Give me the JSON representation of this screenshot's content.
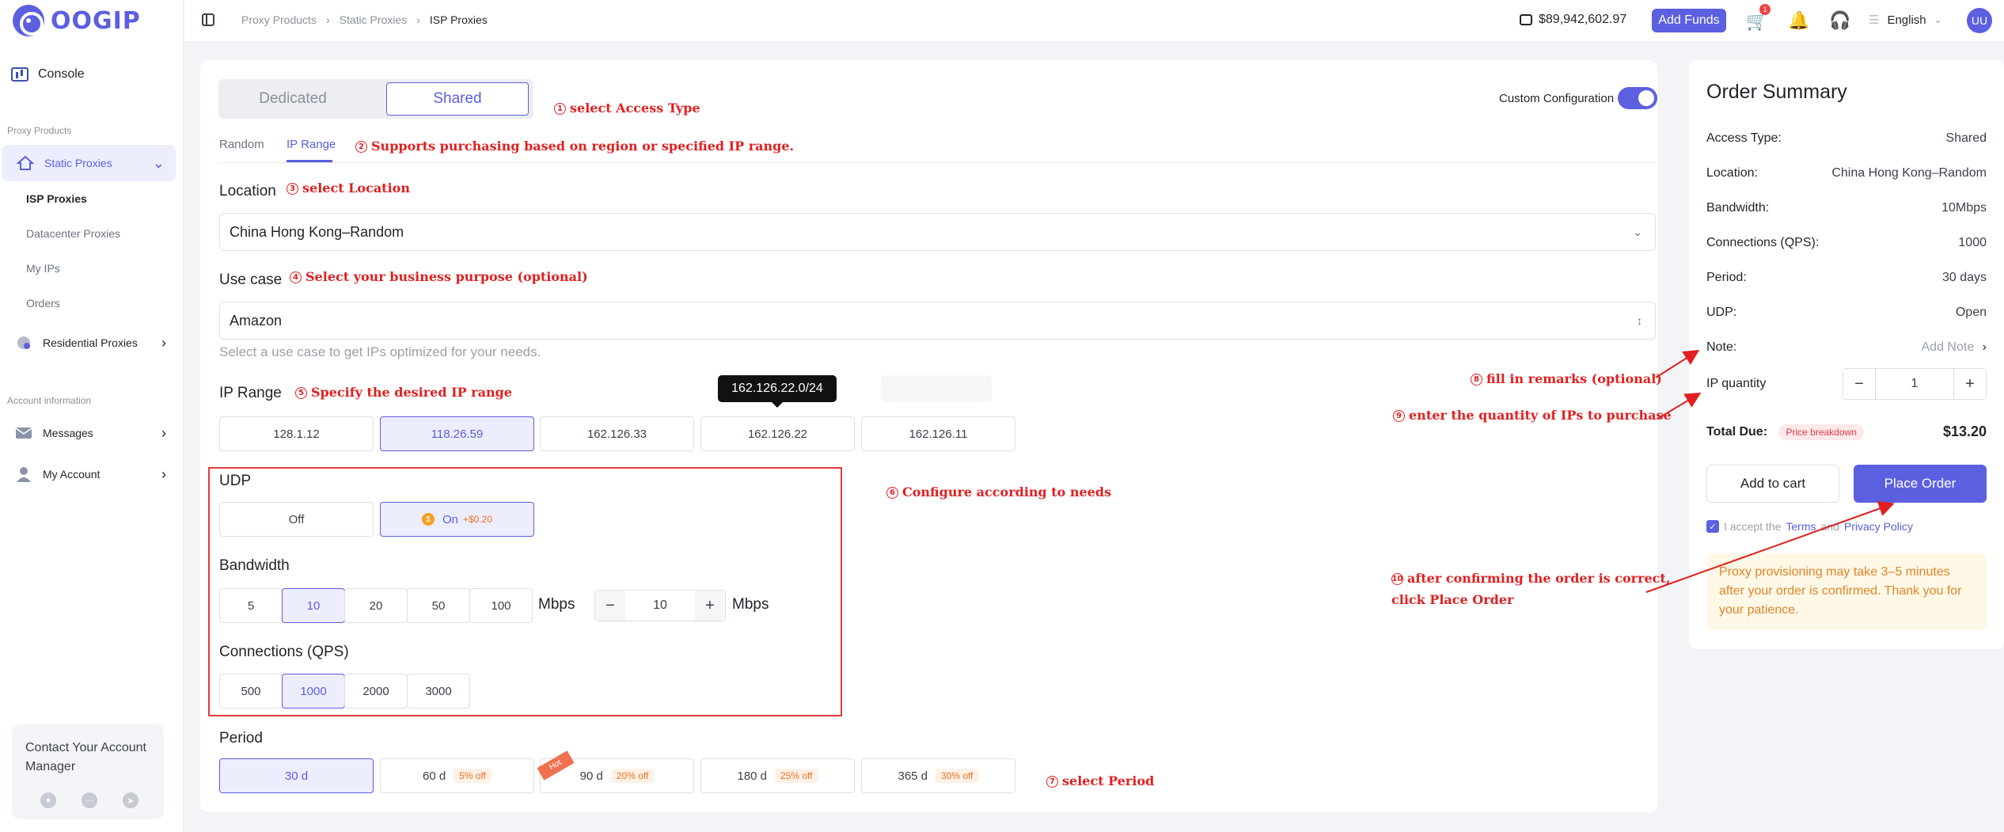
{
  "brand": {
    "logo_text": "OOGIP",
    "accent": "#5b5fe0"
  },
  "sidebar": {
    "console": "Console",
    "section_proxy": "Proxy Products",
    "static_proxies": "Static Proxies",
    "sub_items": [
      "ISP Proxies",
      "Datacenter Proxies",
      "My IPs",
      "Orders"
    ],
    "residential_proxies": "Residential Proxies",
    "section_account": "Account information",
    "messages": "Messages",
    "my_account": "My Account",
    "manager_title": "Contact Your Account Manager"
  },
  "topbar": {
    "breadcrumb": [
      "Proxy Products",
      "Static Proxies",
      "ISP Proxies"
    ],
    "balance": "$89,942,602.97",
    "add_funds": "Add Funds",
    "cart_count": "1",
    "language": "English",
    "avatar": "UU"
  },
  "form": {
    "access_types": [
      "Dedicated",
      "Shared"
    ],
    "selected_access": "Shared",
    "custom_config_label": "Custom Configuration",
    "custom_config_on": true,
    "tabs": [
      "Random",
      "IP Range"
    ],
    "active_tab": "IP Range",
    "location_label": "Location",
    "location_value": "China Hong Kong–Random",
    "usecase_label": "Use case",
    "usecase_value": "Amazon",
    "usecase_hint": "Select a use case to get IPs optimized for your needs.",
    "ip_range_label": "IP Range",
    "ip_ranges": [
      "128.1.12",
      "118.26.59",
      "162.126.33",
      "162.126.22",
      "162.126.11"
    ],
    "ip_range_selected": "118.26.59",
    "ip_tooltip": "162.126.22.0/24",
    "udp_label": "UDP",
    "udp_off": "Off",
    "udp_on": "On",
    "udp_on_price": "+$0.20",
    "bandwidth_label": "Bandwidth",
    "bandwidth_options": [
      "5",
      "10",
      "20",
      "50",
      "100"
    ],
    "bandwidth_selected": "10",
    "bandwidth_unit": "Mbps",
    "bandwidth_custom": "10",
    "connections_label": "Connections (QPS)",
    "connection_options": [
      "500",
      "1000",
      "2000",
      "3000"
    ],
    "connection_selected": "1000",
    "period_label": "Period",
    "periods": [
      {
        "label": "30 d",
        "discount": ""
      },
      {
        "label": "60 d",
        "discount": "5% off"
      },
      {
        "label": "90 d",
        "discount": "20% off"
      },
      {
        "label": "180 d",
        "discount": "25% off"
      },
      {
        "label": "365 d",
        "discount": "30% off"
      }
    ],
    "period_selected": "30 d",
    "hot_tag": "Hot"
  },
  "annotations": {
    "a1": {
      "num": "1",
      "text": "select Access Type"
    },
    "a2": {
      "num": "2",
      "text": "Supports purchasing based on region or specified IP range."
    },
    "a3": {
      "num": "3",
      "text": "select Location"
    },
    "a4": {
      "num": "4",
      "text": "Select your business purpose (optional)"
    },
    "a5": {
      "num": "5",
      "text": "Specify the desired IP range"
    },
    "a6": {
      "num": "6",
      "text": "Configure according to needs"
    },
    "a7": {
      "num": "7",
      "text": "select Period"
    },
    "a8": {
      "num": "8",
      "text": "fill in remarks (optional)"
    },
    "a9": {
      "num": "9",
      "text": "enter the quantity of IPs to purchase"
    },
    "a10": {
      "num": "10",
      "line1": "after confirming the order is correct,",
      "line2": "click Place Order"
    }
  },
  "summary": {
    "title": "Order Summary",
    "rows": [
      {
        "label": "Access Type:",
        "value": "Shared"
      },
      {
        "label": "Location:",
        "value": "China Hong Kong–Random"
      },
      {
        "label": "Bandwidth:",
        "value": "10Mbps"
      },
      {
        "label": "Connections (QPS):",
        "value": "1000"
      },
      {
        "label": "Period:",
        "value": "30 days"
      },
      {
        "label": "UDP:",
        "value": "Open"
      }
    ],
    "note_label": "Note:",
    "note_placeholder": "Add Note",
    "qty_label": "IP quantity",
    "qty_value": "1",
    "total_label": "Total Due:",
    "price_breakdown": "Price breakdown",
    "total_value": "$13.20",
    "add_to_cart": "Add to cart",
    "place_order": "Place Order",
    "terms_prefix": "I accept the",
    "terms_link": "Terms",
    "terms_and": "and",
    "privacy_link": "Privacy Policy",
    "notice": "Proxy provisioning may take 3–5 minutes after your order is confirmed. Thank you for your patience."
  }
}
